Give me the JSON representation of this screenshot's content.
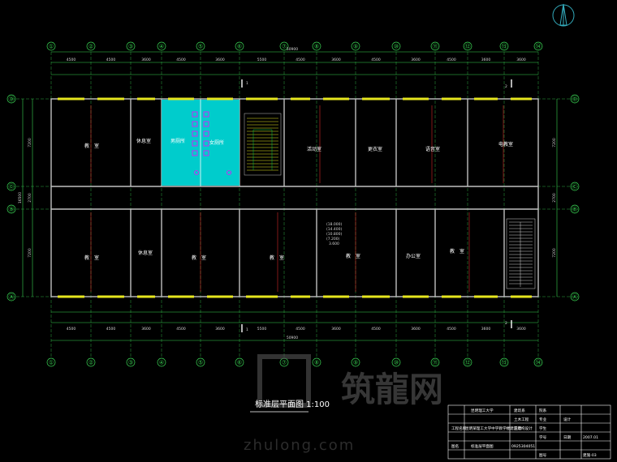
{
  "title": "标准层平面图 1:100",
  "grid_columns": [
    "①",
    "②",
    "③",
    "④",
    "⑤",
    "⑥",
    "⑦",
    "⑧",
    "⑨",
    "⑩",
    "⑪",
    "⑫",
    "⑬",
    "⑭"
  ],
  "grid_rows": [
    "Ⓓ",
    "Ⓒ",
    "Ⓑ",
    "Ⓐ"
  ],
  "dim_top_bays": [
    "4500",
    "4500",
    "3600",
    "4500",
    "3600",
    "5500",
    "4500",
    "3600",
    "4500",
    "3600",
    "4500",
    "3600",
    "3600"
  ],
  "dim_total": "50900",
  "dim_side": [
    "7200",
    "2700",
    "7200",
    "16500"
  ],
  "rooms_north": [
    "教　室",
    "休息室",
    "男厕所",
    "女厕所",
    "活动室",
    "更衣室",
    "语音室",
    "电教室"
  ],
  "rooms_south": [
    "教　室",
    "休息室",
    "教　室",
    "教　室",
    "教　室",
    "办公室",
    "教　室"
  ],
  "elevation_notes": [
    "(18.000)",
    "(14.400)",
    "(10.800)",
    "(7.200)",
    "3.600"
  ],
  "section_marks": [
    "1",
    "2",
    "1",
    "2"
  ],
  "watermark": "筑龍网",
  "watermark_en": "zhulong.com",
  "title_block": {
    "school": "昆明理工大学",
    "dept": "建筑系",
    "topic": "昆明某理工大学中学教学楼建筑结构设计",
    "major": "土木工程",
    "drawing_name": "标准层平面图",
    "student": "王萍",
    "student_id": "0925304051",
    "date": "2007.01",
    "sheet": "建施-03",
    "labels": [
      "院系",
      "专业",
      "学生",
      "学号",
      "图号",
      "日期",
      "设计",
      "工程名称",
      "图名"
    ]
  },
  "colors": {
    "grid": "#39d353",
    "wall": "#c0c0c0",
    "hatch": "#00e6e6",
    "window": "#e6e61e",
    "door": "#1e90ff",
    "red": "#ff3030",
    "magenta": "#ff00ff"
  }
}
